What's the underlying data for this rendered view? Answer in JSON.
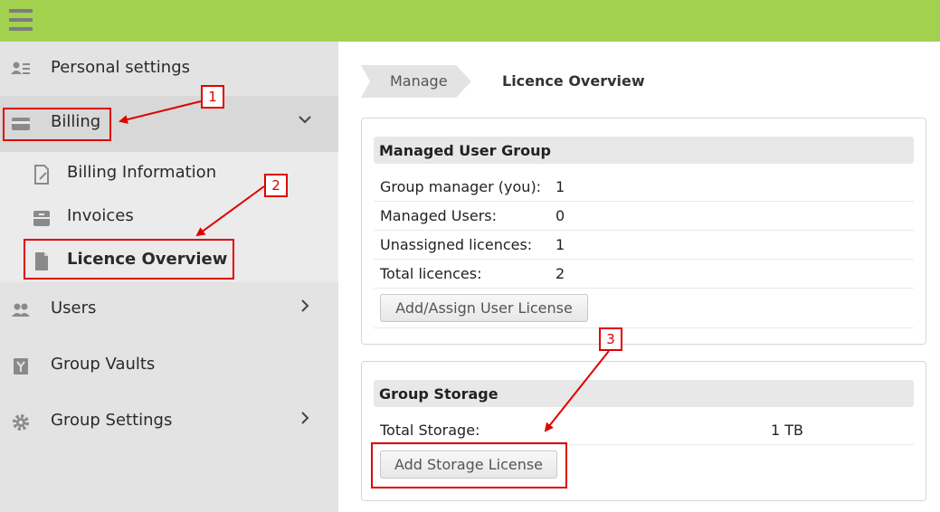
{
  "header": {
    "menu_icon": "hamburger-menu-icon"
  },
  "sidebar": {
    "personal_settings": "Personal settings",
    "billing": "Billing",
    "billing_sub": [
      "Billing Information",
      "Invoices",
      "Licence Overview"
    ],
    "users": "Users",
    "group_vaults": "Group Vaults",
    "group_settings": "Group Settings"
  },
  "breadcrumb": {
    "parent": "Manage",
    "current": "Licence Overview"
  },
  "managed_user_group": {
    "title": "Managed User Group",
    "rows": [
      {
        "label": "Group manager (you):",
        "value": "1"
      },
      {
        "label": "Managed Users:",
        "value": "0"
      },
      {
        "label": "Unassigned licences:",
        "value": "1"
      },
      {
        "label": "Total licences:",
        "value": "2"
      }
    ],
    "button": "Add/Assign User License"
  },
  "group_storage": {
    "title": "Group Storage",
    "rows": [
      {
        "label": "Total Storage:",
        "value": "1 TB"
      }
    ],
    "button": "Add Storage License"
  },
  "annotations": [
    "1",
    "2",
    "3"
  ],
  "colors": {
    "topbar": "#a1d14f",
    "annotation": "#e00000",
    "sidebar": "#e3e3e3"
  }
}
